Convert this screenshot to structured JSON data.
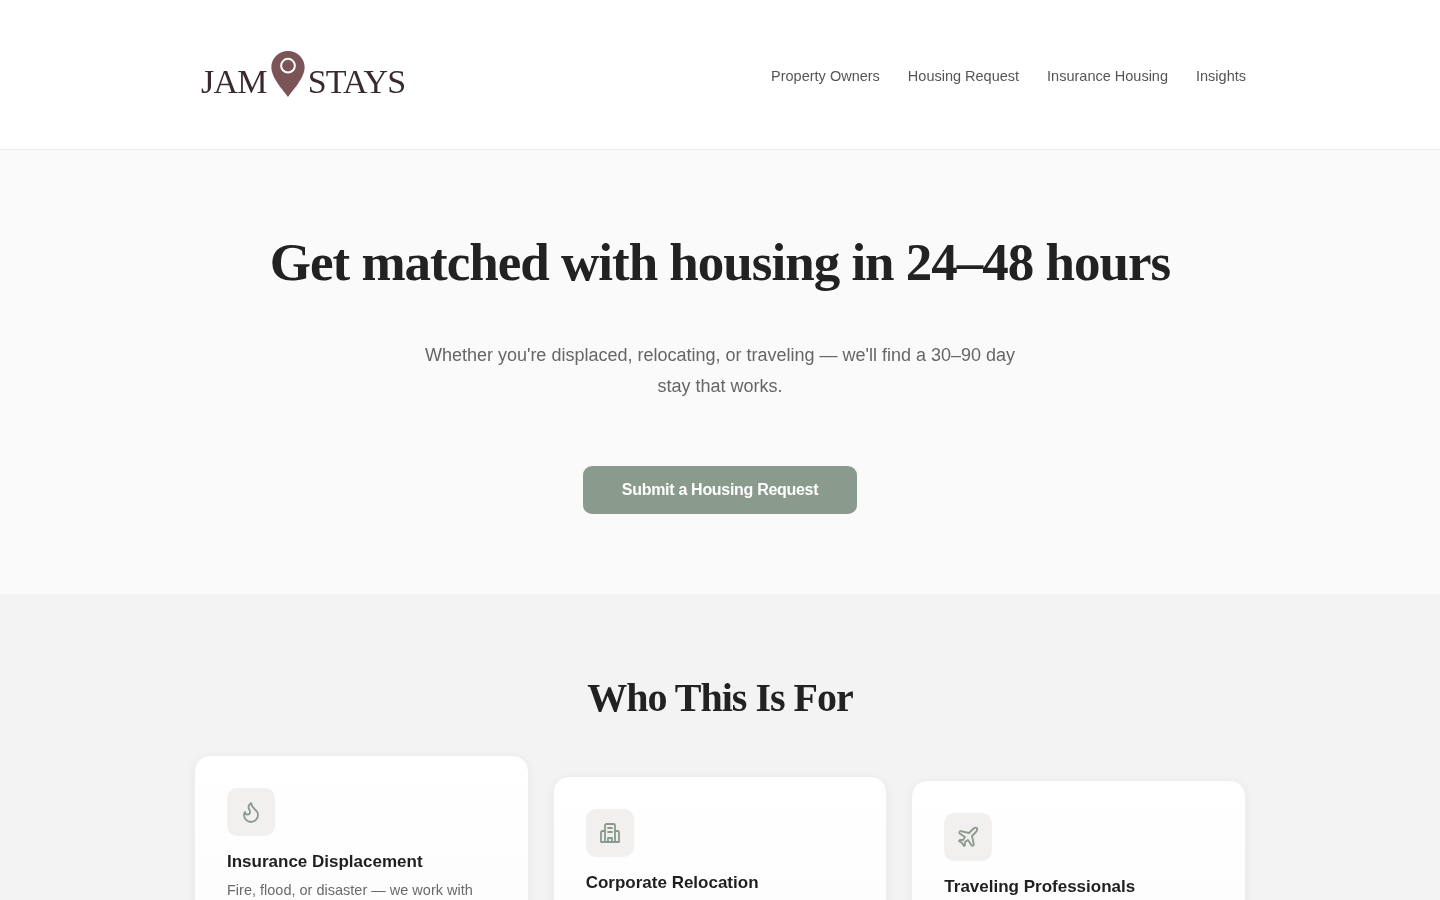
{
  "header": {
    "logo": {
      "left": "JAM",
      "right": "STAYS"
    },
    "nav": [
      "Property Owners",
      "Housing Request",
      "Insurance Housing",
      "Insights"
    ]
  },
  "hero": {
    "title": "Get matched with housing in 24–48 hours",
    "subtitle": "Whether you're displaced, relocating, or traveling — we'll find a 30–90 day stay that works.",
    "cta": "Submit a Housing Request"
  },
  "audience": {
    "title": "Who This Is For",
    "cards": [
      {
        "kind": "flame",
        "title": "Insurance Displacement",
        "description": "Fire, flood, or disaster — we work with"
      },
      {
        "kind": "building",
        "title": "Corporate Relocation"
      },
      {
        "kind": "plane",
        "title": "Traveling Professionals"
      }
    ]
  }
}
